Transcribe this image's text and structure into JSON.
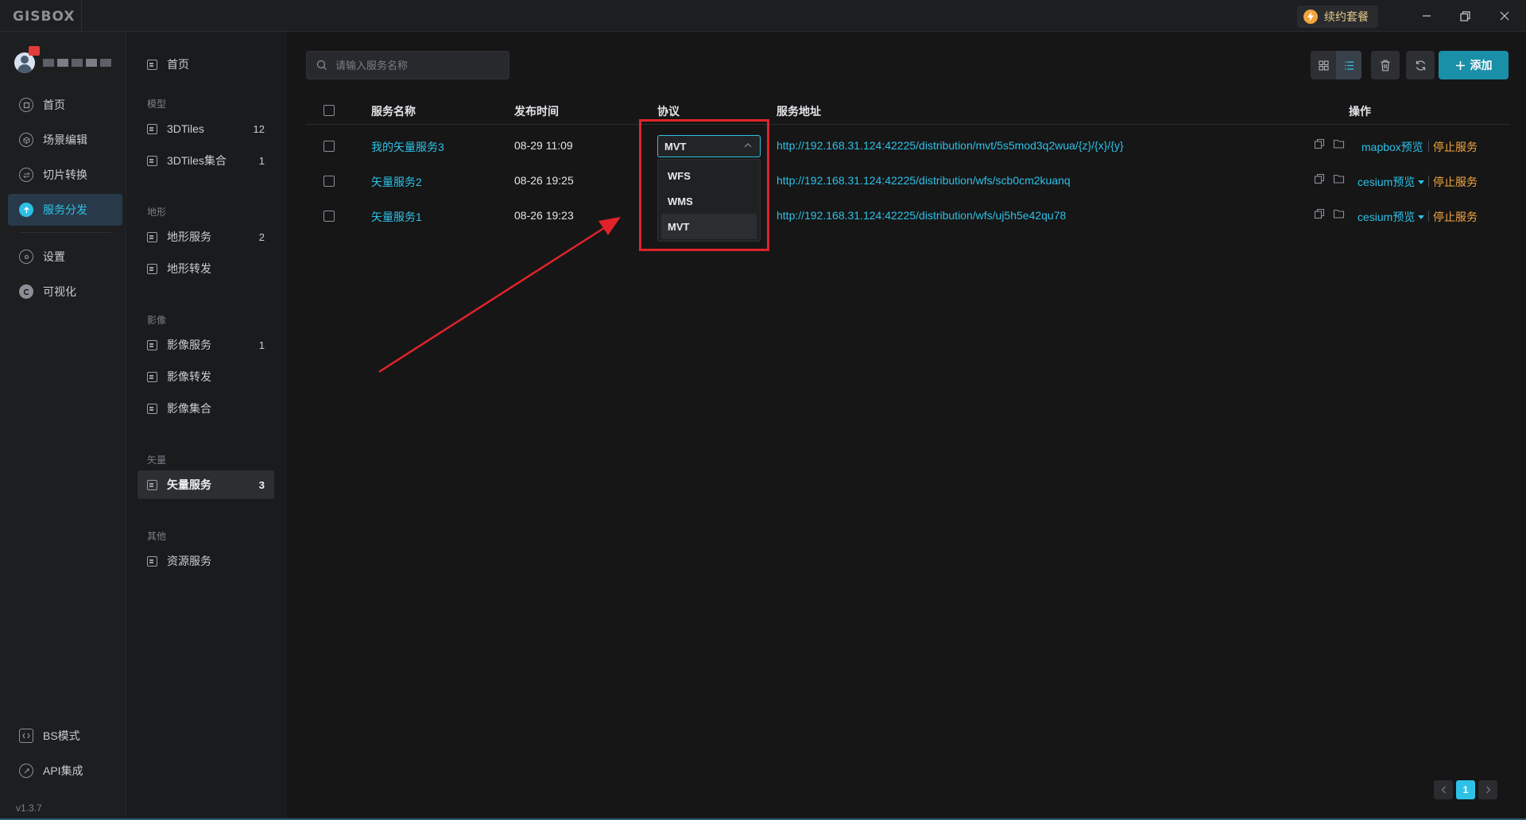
{
  "app": {
    "logo": "GISBOX",
    "renew_label": "续约套餐"
  },
  "user": {
    "name_hidden": true
  },
  "nav": {
    "items": [
      {
        "label": "首页",
        "icon": "home-icon",
        "active": false
      },
      {
        "label": "场景编辑",
        "icon": "cube-icon",
        "active": false
      },
      {
        "label": "切片转换",
        "icon": "convert-icon",
        "active": false
      },
      {
        "label": "服务分发",
        "icon": "upload-icon",
        "active": true
      },
      {
        "label": "设置",
        "icon": "gear-icon",
        "active": false
      },
      {
        "label": "可视化",
        "icon": "visual-icon",
        "active": false
      }
    ],
    "bottom": [
      {
        "label": "BS模式",
        "icon": "code-icon"
      },
      {
        "label": "API集成",
        "icon": "link-icon"
      }
    ],
    "version": "v1.3.7"
  },
  "subnav": {
    "home": "首页",
    "groups": [
      {
        "title": "模型",
        "items": [
          {
            "label": "3DTiles",
            "count": "12"
          },
          {
            "label": "3DTiles集合",
            "count": "1"
          }
        ]
      },
      {
        "title": "地形",
        "items": [
          {
            "label": "地形服务",
            "count": "2"
          },
          {
            "label": "地形转发",
            "count": ""
          }
        ]
      },
      {
        "title": "影像",
        "items": [
          {
            "label": "影像服务",
            "count": "1"
          },
          {
            "label": "影像转发",
            "count": ""
          },
          {
            "label": "影像集合",
            "count": ""
          }
        ]
      },
      {
        "title": "矢量",
        "items": [
          {
            "label": "矢量服务",
            "count": "3"
          }
        ]
      },
      {
        "title": "其他",
        "items": [
          {
            "label": "资源服务",
            "count": ""
          }
        ]
      }
    ]
  },
  "toolbar": {
    "search_placeholder": "请输入服务名称",
    "add_label": "添加"
  },
  "table": {
    "headers": {
      "name": "服务名称",
      "time": "发布时间",
      "protocol": "协议",
      "url": "服务地址",
      "actions": "操作"
    },
    "rows": [
      {
        "name": "我的矢量服务3",
        "time": "08-29 11:09",
        "url": "http://192.168.31.124:42225/distribution/mvt/5s5mod3q2wua/{z}/{x}/{y}",
        "preview": "mapbox预览",
        "has_caret": false,
        "stop": "停止服务"
      },
      {
        "name": "矢量服务2",
        "time": "08-26 19:25",
        "url": "http://192.168.31.124:42225/distribution/wfs/scb0cm2kuanq",
        "preview": "cesium预览",
        "has_caret": true,
        "stop": "停止服务"
      },
      {
        "name": "矢量服务1",
        "time": "08-26 19:23",
        "url": "http://192.168.31.124:42225/distribution/wfs/uj5h5e42qu78",
        "preview": "cesium预览",
        "has_caret": true,
        "stop": "停止服务"
      }
    ]
  },
  "protocol_select": {
    "value": "MVT",
    "options": [
      "WFS",
      "WMS",
      "MVT"
    ],
    "selected": "MVT"
  },
  "pagination": {
    "current": "1"
  },
  "colors": {
    "accent": "#2dc1e6",
    "stop": "#f2a53c",
    "highlight": "#e0232a",
    "add_button": "#1a8fa8"
  }
}
